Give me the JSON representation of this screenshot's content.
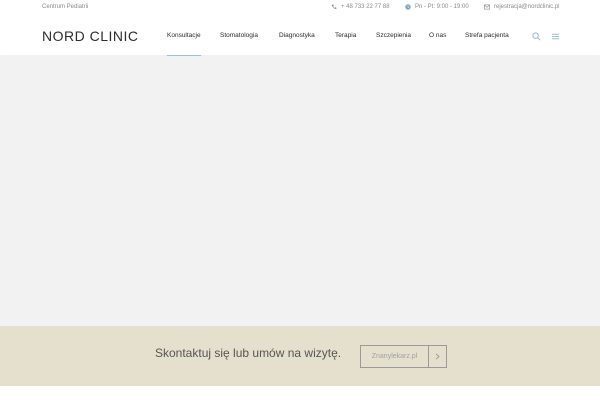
{
  "topbar": {
    "left_text": "Centrum Pediatrii",
    "phone": "+ 48 733 22 77 88",
    "hours": "Pn - Pt: 9:00 - 19:00",
    "email": "rejestracja@nordclinic.pl",
    "icons": [
      "phone-icon",
      "clock-icon",
      "mail-icon"
    ]
  },
  "header": {
    "logo": "NORD CLINIC",
    "nav": [
      "Konsultacje",
      "Stomatologia",
      "Diagnostyka",
      "Terapia",
      "Szczepienia",
      "O nas",
      "Strefa pacjenta"
    ],
    "active_index": 0,
    "icons": [
      "search-icon",
      "hamburger-menu-icon"
    ]
  },
  "band": {
    "text": "Skontaktuj się lub umów na wizytę.",
    "button_label": "Znanylekarz.pl",
    "button_icon": "chevron-right-icon"
  },
  "colors": {
    "accent": "#9cc0d3",
    "band_bg": "#e5e0cd",
    "hero_bg": "#f2f2f2"
  }
}
